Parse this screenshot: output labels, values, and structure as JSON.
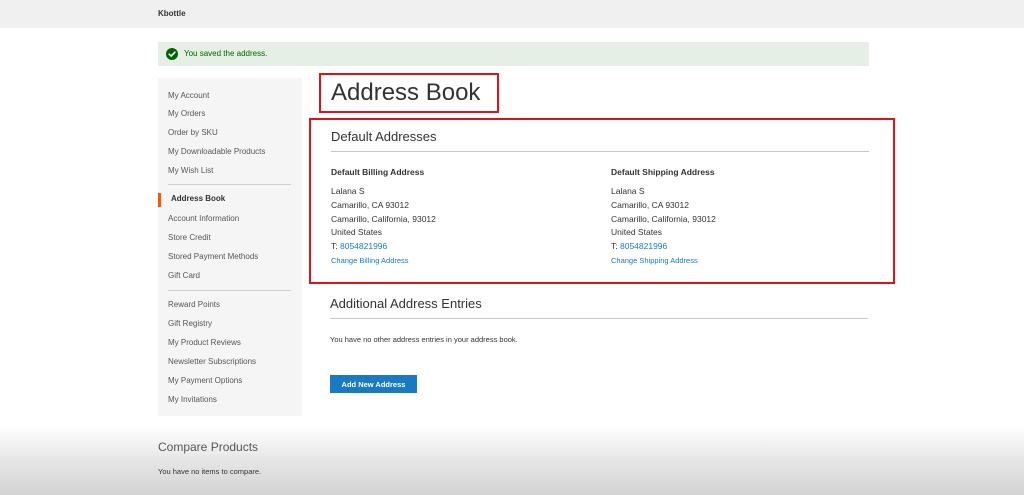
{
  "header": {
    "store_name": "Kbottle"
  },
  "message": {
    "text": "You saved the address."
  },
  "sidebar": {
    "items": [
      {
        "label": "My Account"
      },
      {
        "label": "My Orders"
      },
      {
        "label": "Order by SKU"
      },
      {
        "label": "My Downloadable Products"
      },
      {
        "label": "My Wish List"
      },
      {
        "label": "Address Book",
        "current": true
      },
      {
        "label": "Account Information"
      },
      {
        "label": "Store Credit"
      },
      {
        "label": "Stored Payment Methods"
      },
      {
        "label": "Gift Card"
      },
      {
        "label": "Reward Points"
      },
      {
        "label": "Gift Registry"
      },
      {
        "label": "My Product Reviews"
      },
      {
        "label": "Newsletter Subscriptions"
      },
      {
        "label": "My Payment Options"
      },
      {
        "label": "My Invitations"
      }
    ]
  },
  "page": {
    "title": "Address Book"
  },
  "default_addresses": {
    "title": "Default Addresses",
    "billing": {
      "heading": "Default Billing Address",
      "name": "Lalana S",
      "line1": "Camarillo, CA 93012",
      "line2": "Camarillo, California, 93012",
      "country": "United States",
      "phone_prefix": "T: ",
      "phone": "8054821996",
      "change_link": "Change Billing Address"
    },
    "shipping": {
      "heading": "Default Shipping Address",
      "name": "Lalana S",
      "line1": "Camarillo, CA 93012",
      "line2": "Camarillo, California, 93012",
      "country": "United States",
      "phone_prefix": "T: ",
      "phone": "8054821996",
      "change_link": "Change Shipping Address"
    }
  },
  "additional": {
    "title": "Additional Address Entries",
    "empty_text": "You have no other address entries in your address book.",
    "add_button": "Add New Address"
  },
  "compare": {
    "title": "Compare Products",
    "empty_text": "You have no items to compare."
  },
  "colors": {
    "accent": "#1979c3",
    "success_bg": "#e5efe5",
    "success_text": "#006400",
    "highlight_border": "#d9141d",
    "current_nav_marker": "#ff5501"
  },
  "icons": {
    "success": "check-circle-icon"
  }
}
